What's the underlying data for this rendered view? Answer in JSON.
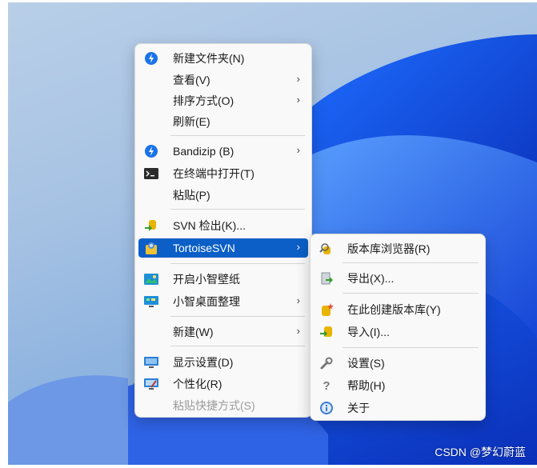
{
  "main_menu": {
    "items": [
      {
        "label": "新建文件夹(N)",
        "icon": "new-folder-icon"
      },
      {
        "label": "查看(V)",
        "arrow": "›"
      },
      {
        "label": "排序方式(O)",
        "arrow": "›"
      },
      {
        "label": "刷新(E)"
      },
      {
        "label": "Bandizip (B)",
        "icon": "bandizip-icon",
        "arrow": "›"
      },
      {
        "label": "在终端中打开(T)",
        "icon": "terminal-icon"
      },
      {
        "label": "粘贴(P)"
      },
      {
        "label": "SVN 检出(K)...",
        "icon": "svn-checkout-icon"
      },
      {
        "label": "TortoiseSVN",
        "icon": "tortoisesvn-icon",
        "arrow": "›"
      },
      {
        "label": "开启小智壁纸",
        "icon": "wallpaper-icon"
      },
      {
        "label": "小智桌面整理",
        "icon": "desktop-organize-icon",
        "arrow": "›"
      },
      {
        "label": "新建(W)",
        "arrow": "›"
      },
      {
        "label": "显示设置(D)",
        "icon": "display-icon"
      },
      {
        "label": "个性化(R)",
        "icon": "personalize-icon"
      },
      {
        "label": "粘贴快捷方式(S)"
      }
    ]
  },
  "sub_menu": {
    "items": [
      {
        "label": "版本库浏览器(R)",
        "icon": "repo-browser-icon"
      },
      {
        "label": "导出(X)...",
        "icon": "export-icon"
      },
      {
        "label": "在此创建版本库(Y)",
        "icon": "create-repo-icon"
      },
      {
        "label": "导入(I)...",
        "icon": "import-icon"
      },
      {
        "label": "设置(S)",
        "icon": "settings-wrench-icon"
      },
      {
        "label": "帮助(H)",
        "icon": "help-icon"
      },
      {
        "label": "关于",
        "icon": "about-icon"
      }
    ]
  },
  "watermark": "CSDN @梦幻蔚蓝",
  "colors": {
    "highlight": "#0b5fc6",
    "menu_bg": "#f9f9f9"
  }
}
